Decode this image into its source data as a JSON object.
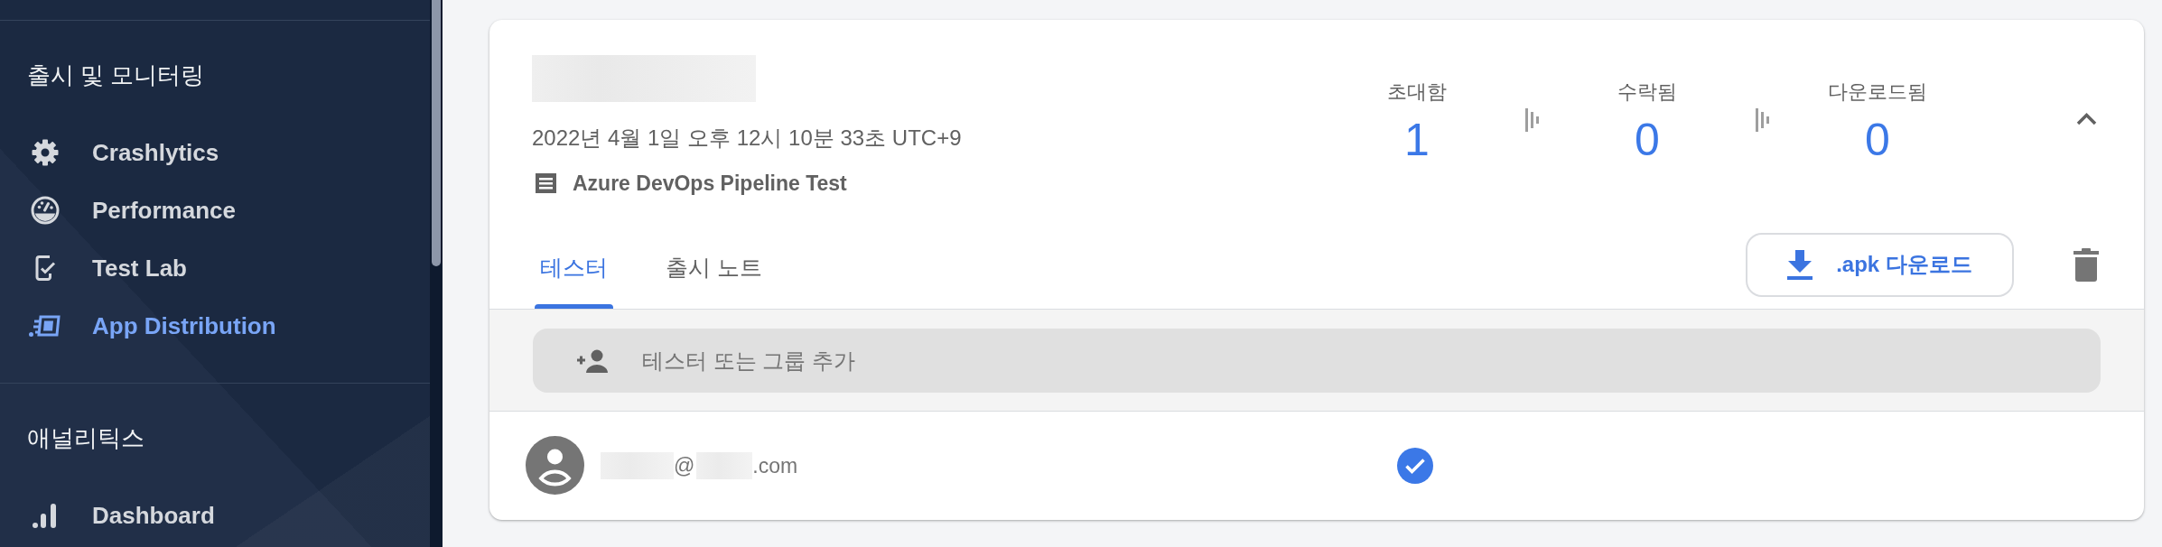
{
  "sidebar": {
    "sections": [
      {
        "title": "출시 및 모니터링",
        "items": [
          {
            "kind": "crash",
            "label": "Crashlytics",
            "selected": false
          },
          {
            "kind": "gauge",
            "label": "Performance",
            "selected": false
          },
          {
            "kind": "testlab",
            "label": "Test Lab",
            "selected": false
          },
          {
            "kind": "distribution",
            "label": "App Distribution",
            "selected": true
          }
        ]
      },
      {
        "title": "애널리틱스",
        "items": [
          {
            "kind": "dashboard",
            "label": "Dashboard",
            "selected": false
          }
        ]
      }
    ]
  },
  "release": {
    "date": "2022년 4월 1일 오후 12시 10분 33초 UTC+9",
    "notes_source": "Azure DevOps Pipeline Test",
    "stats": [
      {
        "label": "초대함",
        "value": "1"
      },
      {
        "label": "수락됨",
        "value": "0"
      },
      {
        "label": "다운로드됨",
        "value": "0"
      }
    ],
    "expanded": true,
    "tabs": [
      {
        "label": "테스터",
        "selected": true
      },
      {
        "label": "출시 노트",
        "selected": false
      }
    ],
    "download_button": {
      "label": ".apk 다운로드"
    },
    "add_tester_field": {
      "placeholder": "테스터 또는 그룹 추가"
    },
    "testers": [
      {
        "email_fragments": [
          "@",
          ".com"
        ],
        "invited": true
      }
    ]
  }
}
